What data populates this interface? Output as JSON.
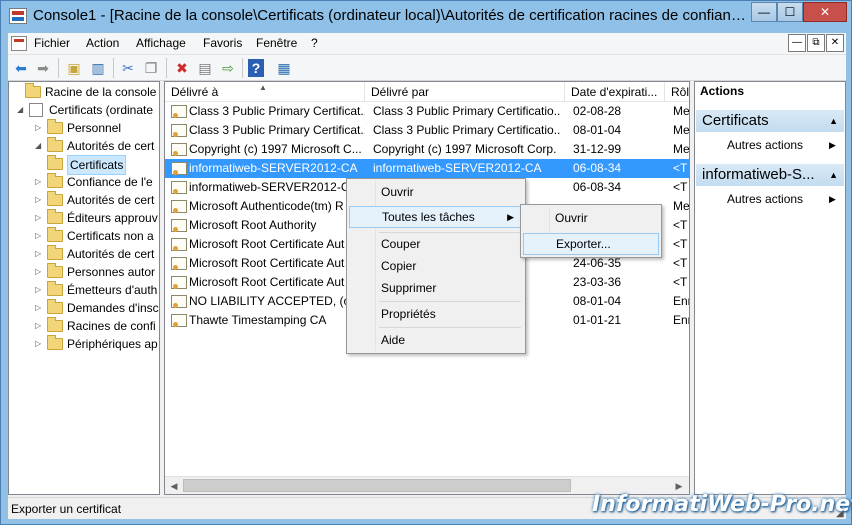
{
  "window": {
    "title": "Console1 - [Racine de la console\\Certificats (ordinateur local)\\Autorités de certification racines de confiance...",
    "min": "—",
    "max": "☐",
    "close": "✕"
  },
  "menubar": {
    "items": [
      "Fichier",
      "Action",
      "Affichage",
      "Favoris",
      "Fenêtre",
      "?"
    ],
    "mdi_min": "—",
    "mdi_restore": "⧉",
    "mdi_close": "✕"
  },
  "toolbar": {
    "icons": [
      "back-arrow-icon",
      "forward-arrow-icon",
      "up-folder-icon",
      "show-hide-tree-icon",
      "cut-icon",
      "copy-icon",
      "delete-icon",
      "properties-icon",
      "export-list-icon",
      "help-icon",
      "action-pane-icon"
    ]
  },
  "tree": {
    "items": [
      {
        "label": "Racine de la console",
        "level": 0,
        "toggle": ""
      },
      {
        "label": "Certificats (ordinate",
        "level": 1,
        "toggle": "◢"
      },
      {
        "label": "Personnel",
        "level": 2,
        "toggle": "▷"
      },
      {
        "label": "Autorités de cert",
        "level": 2,
        "toggle": "◢"
      },
      {
        "label": "Certificats",
        "level": 3,
        "toggle": "",
        "selected": true
      },
      {
        "label": "Confiance de l'e",
        "level": 2,
        "toggle": "▷"
      },
      {
        "label": "Autorités de cert",
        "level": 2,
        "toggle": "▷"
      },
      {
        "label": "Éditeurs approuv",
        "level": 2,
        "toggle": "▷"
      },
      {
        "label": "Certificats non a",
        "level": 2,
        "toggle": "▷"
      },
      {
        "label": "Autorités de cert",
        "level": 2,
        "toggle": "▷"
      },
      {
        "label": "Personnes autor",
        "level": 2,
        "toggle": "▷"
      },
      {
        "label": "Émetteurs d'auth",
        "level": 2,
        "toggle": "▷"
      },
      {
        "label": "Demandes d'insc",
        "level": 2,
        "toggle": "▷"
      },
      {
        "label": "Racines de confi",
        "level": 2,
        "toggle": "▷"
      },
      {
        "label": "Périphériques ap",
        "level": 2,
        "toggle": "▷"
      }
    ]
  },
  "list": {
    "columns": [
      "Délivré à",
      "Délivré par",
      "Date d'expirati...",
      "Rôl"
    ],
    "sort_arrow": "▲",
    "rows": [
      {
        "issued_to": "Class 3 Public Primary Certificat...",
        "issued_by": "Class 3 Public Primary Certificatio...",
        "expires": "02-08-28",
        "role": "Me"
      },
      {
        "issued_to": "Class 3 Public Primary Certificat...",
        "issued_by": "Class 3 Public Primary Certificatio...",
        "expires": "08-01-04",
        "role": "Me"
      },
      {
        "issued_to": "Copyright (c) 1997 Microsoft C...",
        "issued_by": "Copyright (c) 1997 Microsoft Corp.",
        "expires": "31-12-99",
        "role": "Me"
      },
      {
        "issued_to": "informatiweb-SERVER2012-CA",
        "issued_by": "informatiweb-SERVER2012-CA",
        "expires": "06-08-34",
        "role": "<T",
        "selected": true
      },
      {
        "issued_to": "informatiweb-SERVER2012-CA",
        "issued_by": "CA",
        "expires": "06-08-34",
        "role": "<T"
      },
      {
        "issued_to": "Microsoft Authenticode(tm) R",
        "issued_by": "",
        "expires": "",
        "role": "Me"
      },
      {
        "issued_to": "Microsoft Root Authority",
        "issued_by": "",
        "expires": "",
        "role": "<T"
      },
      {
        "issued_to": "Microsoft Root Certificate Aut",
        "issued_by": "",
        "expires": "",
        "role": "<T"
      },
      {
        "issued_to": "Microsoft Root Certificate Aut",
        "issued_by": "thori...",
        "expires": "24-06-35",
        "role": "<T"
      },
      {
        "issued_to": "Microsoft Root Certificate Aut",
        "issued_by": "thori...",
        "expires": "23-03-36",
        "role": "<T"
      },
      {
        "issued_to": "NO LIABILITY ACCEPTED, (c)9",
        "issued_by": "97 V...",
        "expires": "08-01-04",
        "role": "Enr"
      },
      {
        "issued_to": "Thawte Timestamping CA",
        "issued_by": "",
        "expires": "01-01-21",
        "role": "Enr"
      }
    ]
  },
  "actions": {
    "title": "Actions",
    "sections": [
      {
        "header": "Certificats",
        "item": "Autres actions"
      },
      {
        "header": "informatiweb-S...",
        "item": "Autres actions"
      }
    ],
    "collapse_arrow": "▲",
    "item_arrow": "▶"
  },
  "context_menu": {
    "items": [
      "Ouvrir",
      "Toutes les tâches",
      "Couper",
      "Copier",
      "Supprimer",
      "Propriétés",
      "Aide"
    ],
    "submenu_arrow": "▶"
  },
  "submenu": {
    "items": [
      "Ouvrir",
      "Exporter..."
    ]
  },
  "statusbar": {
    "text": "Exporter un certificat"
  },
  "watermark": {
    "text": "InformatiWeb-Pro.net"
  }
}
